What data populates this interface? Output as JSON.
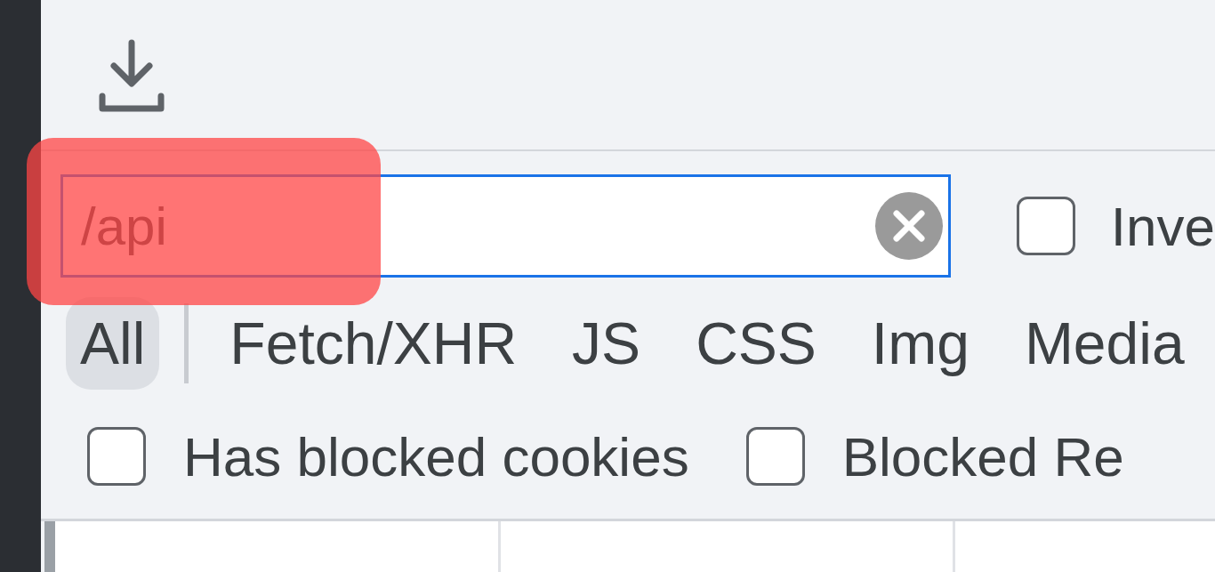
{
  "filter": {
    "value": "/api",
    "invert": {
      "label": "Inve",
      "checked": false
    }
  },
  "types": [
    {
      "label": "All",
      "selected": true
    },
    {
      "label": "Fetch/XHR",
      "selected": false
    },
    {
      "label": "JS",
      "selected": false
    },
    {
      "label": "CSS",
      "selected": false
    },
    {
      "label": "Img",
      "selected": false
    },
    {
      "label": "Media",
      "selected": false
    }
  ],
  "options": [
    {
      "label": "Has blocked cookies",
      "checked": false
    },
    {
      "label": "Blocked Re",
      "checked": false
    }
  ]
}
